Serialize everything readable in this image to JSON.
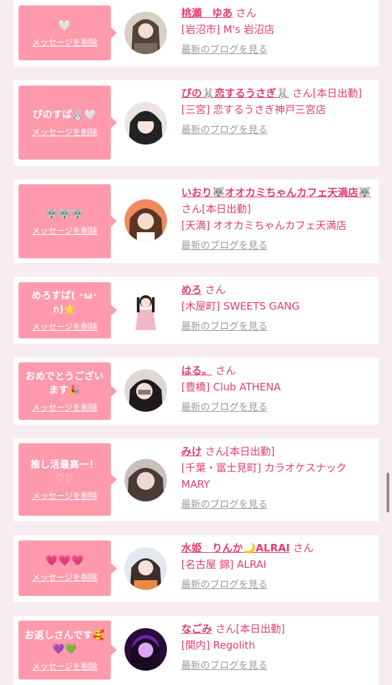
{
  "common": {
    "delete_label": "メッセージを削除",
    "blog_label": "最新のブログを見る"
  },
  "cards": [
    {
      "message": "🤍",
      "name": "桃瀬　ゆあ",
      "suffix": "さん",
      "shop": "[岩沼市] M's 岩沼店"
    },
    {
      "message": "ぴのすぱ🐰🤍",
      "name": "ぴの🐰恋するうさぎ🐰",
      "suffix": "さん[本日出勤]",
      "shop": "[三宮] 恋するうさぎ神戸三宮店"
    },
    {
      "message": "🐺🐺🐺",
      "name": "いおり🐺オオカミちゃんカフェ天満店🐺",
      "suffix": "さん[本日出勤]",
      "shop": "[天満] オオカミちゃんカフェ天満店"
    },
    {
      "message": "めろすぱ( ･ω･ก)⭐",
      "name": "めろ",
      "suffix": "さん",
      "shop": "[木屋町] SWEETS GANG"
    },
    {
      "message": "おめでとうございます🎉",
      "name": "はる。",
      "suffix": "さん",
      "shop": "[豊橋] Club ATHENA"
    },
    {
      "message": "推し活最高一！♡♡",
      "name": "みけ",
      "suffix": "さん[本日出勤]",
      "shop": "[千葉・富士見町] カラオケスナック MARY"
    },
    {
      "message": "💗💗💗",
      "name": "水姫　りんか🌙ALRAI",
      "suffix": "さん",
      "shop": "[名古屋 錦] ALRAI"
    },
    {
      "message": "お返しさんです🥰💜💚",
      "name": "なごみ",
      "suffix": "さん[本日出勤]",
      "shop": "[関内] Regolith"
    }
  ]
}
